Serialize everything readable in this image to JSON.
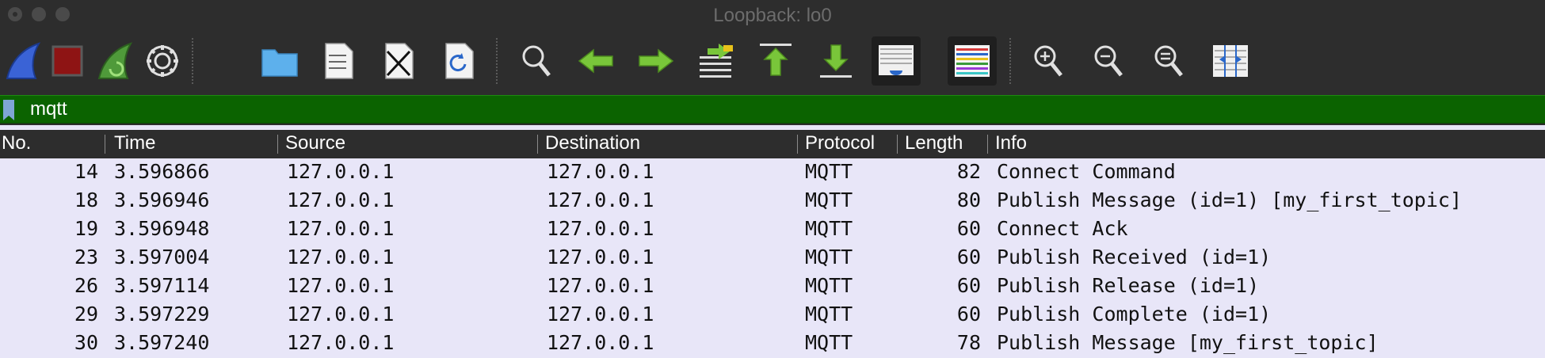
{
  "window": {
    "title": "Loopback: lo0"
  },
  "toolbar": {
    "buttons": [
      {
        "name": "start-capture-button",
        "icon": "shark-fin-icon"
      },
      {
        "name": "stop-capture-button",
        "icon": "stop-square-icon"
      },
      {
        "name": "restart-capture-button",
        "icon": "restart-fin-icon"
      },
      {
        "name": "capture-options-button",
        "icon": "gear-icon"
      },
      {
        "name": "open-file-button",
        "icon": "folder-icon"
      },
      {
        "name": "save-file-button",
        "icon": "binary-file-icon"
      },
      {
        "name": "close-file-button",
        "icon": "close-file-icon"
      },
      {
        "name": "reload-file-button",
        "icon": "reload-file-icon"
      },
      {
        "name": "find-packet-button",
        "icon": "magnifier-icon"
      },
      {
        "name": "go-back-button",
        "icon": "arrow-left-icon"
      },
      {
        "name": "go-forward-button",
        "icon": "arrow-right-icon"
      },
      {
        "name": "go-to-packet-button",
        "icon": "jump-to-icon"
      },
      {
        "name": "go-first-packet-button",
        "icon": "arrow-up-bar-icon"
      },
      {
        "name": "go-last-packet-button",
        "icon": "arrow-down-bar-icon"
      },
      {
        "name": "auto-scroll-button",
        "icon": "autoscroll-icon"
      },
      {
        "name": "colorize-button",
        "icon": "colorize-lines-icon"
      },
      {
        "name": "zoom-in-button",
        "icon": "zoom-in-icon"
      },
      {
        "name": "zoom-out-button",
        "icon": "zoom-out-icon"
      },
      {
        "name": "zoom-reset-button",
        "icon": "zoom-normal-icon"
      },
      {
        "name": "resize-columns-button",
        "icon": "resize-columns-icon"
      }
    ]
  },
  "filter": {
    "value": "mqtt",
    "background": "#0b6300"
  },
  "columns": [
    "No.",
    "Time",
    "Source",
    "Destination",
    "Protocol",
    "Length",
    "Info"
  ],
  "packets": [
    {
      "no": "14",
      "time": "3.596866",
      "source": "127.0.0.1",
      "destination": "127.0.0.1",
      "protocol": "MQTT",
      "length": "82",
      "info": "Connect Command"
    },
    {
      "no": "18",
      "time": "3.596946",
      "source": "127.0.0.1",
      "destination": "127.0.0.1",
      "protocol": "MQTT",
      "length": "80",
      "info": "Publish Message (id=1) [my_first_topic]"
    },
    {
      "no": "19",
      "time": "3.596948",
      "source": "127.0.0.1",
      "destination": "127.0.0.1",
      "protocol": "MQTT",
      "length": "60",
      "info": "Connect Ack"
    },
    {
      "no": "23",
      "time": "3.597004",
      "source": "127.0.0.1",
      "destination": "127.0.0.1",
      "protocol": "MQTT",
      "length": "60",
      "info": "Publish Received (id=1)"
    },
    {
      "no": "26",
      "time": "3.597114",
      "source": "127.0.0.1",
      "destination": "127.0.0.1",
      "protocol": "MQTT",
      "length": "60",
      "info": "Publish Release (id=1)"
    },
    {
      "no": "29",
      "time": "3.597229",
      "source": "127.0.0.1",
      "destination": "127.0.0.1",
      "protocol": "MQTT",
      "length": "60",
      "info": "Publish Complete (id=1)"
    },
    {
      "no": "30",
      "time": "3.597240",
      "source": "127.0.0.1",
      "destination": "127.0.0.1",
      "protocol": "MQTT",
      "length": "78",
      "info": "Publish Message [my_first_topic]"
    }
  ],
  "colors": {
    "row_background": "#e8e6f8",
    "chrome": "#2d2d2d",
    "filter_valid": "#0b6300"
  }
}
